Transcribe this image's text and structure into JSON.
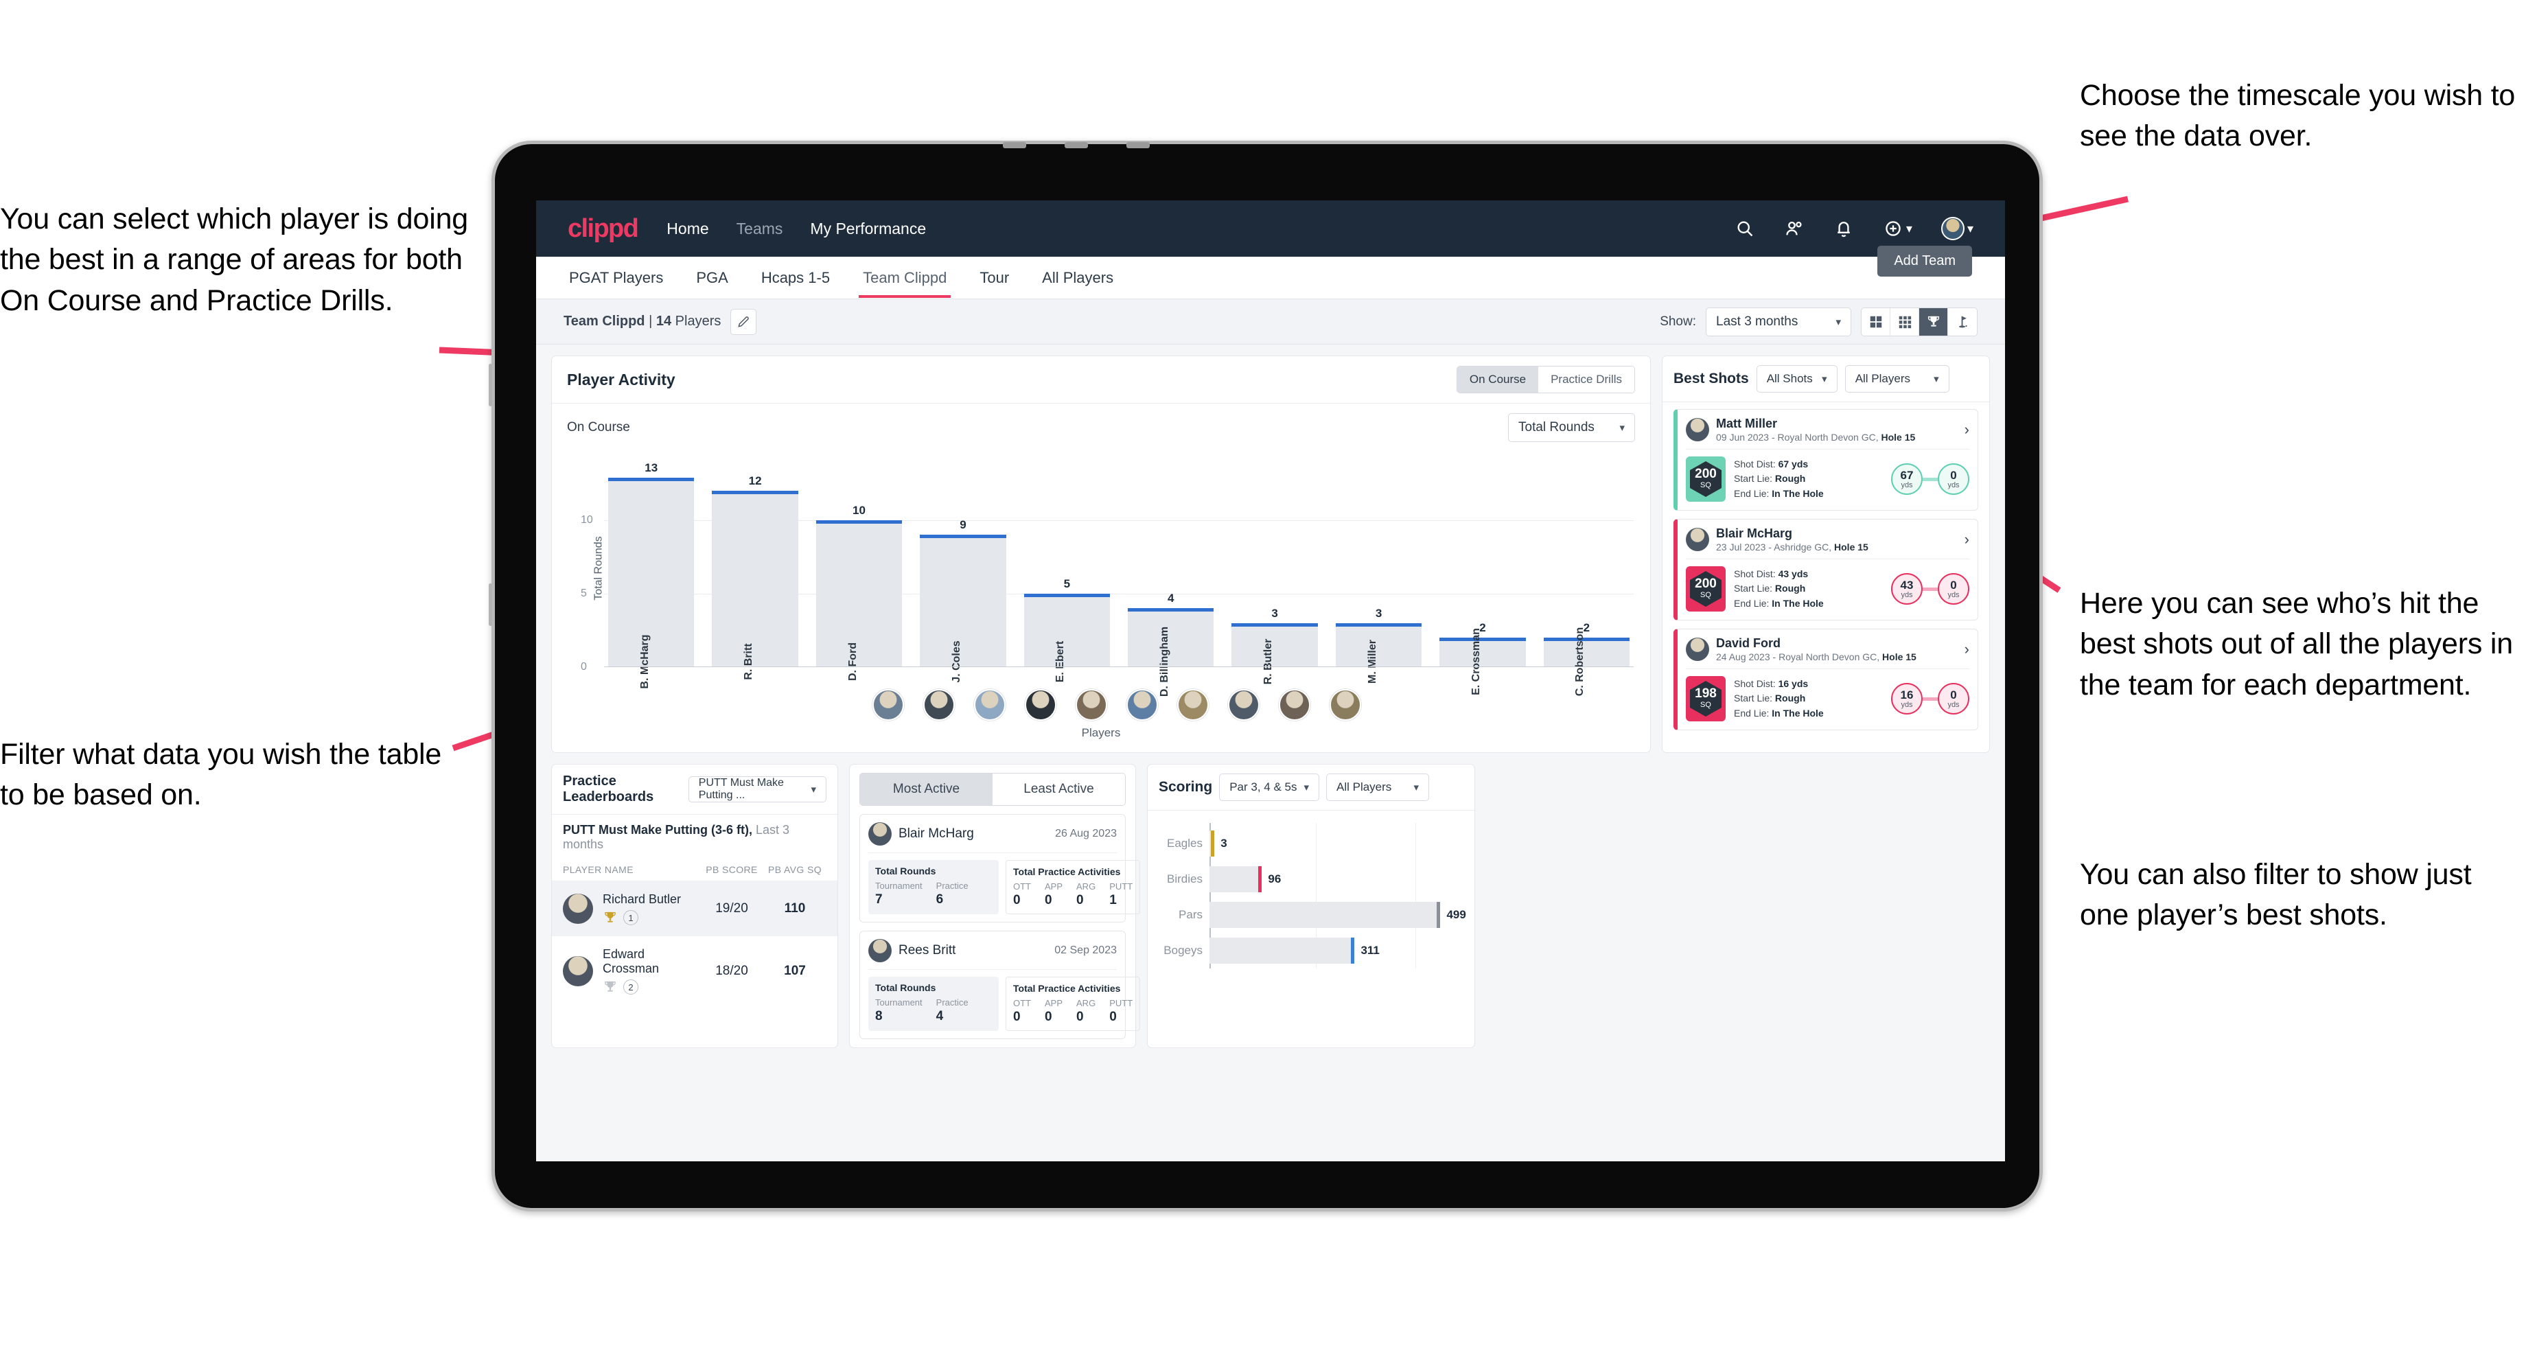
{
  "annotations": {
    "left_top": "You can select which player is doing the best in a range of areas for both On Course and Practice Drills.",
    "left_bottom": "Filter what data you wish the table to be based on.",
    "right_top": "Choose the timescale you wish to see the data over.",
    "right_mid": "Here you can see who’s hit the best shots out of all the players in the team for each department.",
    "right_bottom": "You can also filter to show just one player’s best shots."
  },
  "navbar": {
    "logo": "clippd",
    "links": [
      {
        "label": "Home",
        "active": true
      },
      {
        "label": "Teams",
        "active": false
      },
      {
        "label": "My Performance",
        "active": true
      }
    ],
    "icons": [
      "search-icon",
      "people-icon",
      "bell-icon",
      "plus-circle-icon",
      "avatar-icon"
    ]
  },
  "tabs": [
    {
      "label": "PGAT Players",
      "active": false
    },
    {
      "label": "PGA",
      "active": false
    },
    {
      "label": "Hcaps 1-5",
      "active": false
    },
    {
      "label": "Team Clippd",
      "active": true
    },
    {
      "label": "Tour",
      "active": false
    },
    {
      "label": "All Players",
      "active": false
    }
  ],
  "add_team_button": "Add Team",
  "subheader": {
    "team_name": "Team Clippd",
    "player_count": "14",
    "players_word": "Players",
    "show_label": "Show:",
    "timescale_value": "Last 3 months",
    "view_toggles": [
      {
        "name": "grid-large-icon",
        "selected": false
      },
      {
        "name": "grid-small-icon",
        "selected": false
      },
      {
        "name": "trophy-icon",
        "selected": true
      },
      {
        "name": "flag-icon",
        "selected": false
      }
    ]
  },
  "player_activity": {
    "title": "Player Activity",
    "segments": [
      {
        "label": "On Course",
        "selected": true
      },
      {
        "label": "Practice Drills",
        "selected": false
      }
    ],
    "sub_label": "On Course",
    "metric_value": "Total Rounds"
  },
  "chart_data": [
    {
      "type": "bar",
      "title": "Player Activity - On Course",
      "xlabel": "Players",
      "ylabel": "Total Rounds",
      "categories": [
        "B. McHarg",
        "R. Britt",
        "D. Ford",
        "J. Coles",
        "E. Ebert",
        "D. Billingham",
        "R. Butler",
        "M. Miller",
        "E. Crossman",
        "C. Robertson"
      ],
      "values": [
        13,
        12,
        10,
        9,
        5,
        4,
        3,
        3,
        2,
        2
      ],
      "ylim": [
        0,
        14
      ],
      "yticks": [
        0,
        5,
        10
      ],
      "grid": true,
      "bar_color": "#e4e7ec",
      "cap_color": "#2f6fd0"
    },
    {
      "type": "bar",
      "orientation": "horizontal",
      "title": "Scoring",
      "categories": [
        "Eagles",
        "Birdies",
        "Pars",
        "Bogeys"
      ],
      "values": [
        3,
        96,
        499,
        311
      ],
      "colors": [
        "#c9a227",
        "#e8305f",
        "#8a9099",
        "#3b82d6"
      ],
      "xlim": [
        0,
        560
      ],
      "grid": true
    }
  ],
  "best_shots": {
    "title": "Best Shots",
    "filter_shots": "All Shots",
    "filter_players": "All Players",
    "shots": [
      {
        "player": "Matt Miller",
        "meta_date": "09 Jun 2023",
        "meta_course": "Royal North Devon GC,",
        "meta_hole": "Hole 15",
        "badge_value": "200",
        "badge_unit": "SQ",
        "accent": "teal",
        "shot_dist_label": "Shot Dist:",
        "shot_dist": "67 yds",
        "start_lie_label": "Start Lie:",
        "start_lie": "Rough",
        "end_lie_label": "End Lie:",
        "end_lie": "In The Hole",
        "start_num": "67",
        "start_unit": "yds",
        "end_num": "0",
        "end_unit": "yds"
      },
      {
        "player": "Blair McHarg",
        "meta_date": "23 Jul 2023",
        "meta_course": "Ashridge GC,",
        "meta_hole": "Hole 15",
        "badge_value": "200",
        "badge_unit": "SQ",
        "accent": "pink",
        "shot_dist_label": "Shot Dist:",
        "shot_dist": "43 yds",
        "start_lie_label": "Start Lie:",
        "start_lie": "Rough",
        "end_lie_label": "End Lie:",
        "end_lie": "In The Hole",
        "start_num": "43",
        "start_unit": "yds",
        "end_num": "0",
        "end_unit": "yds"
      },
      {
        "player": "David Ford",
        "meta_date": "24 Aug 2023",
        "meta_course": "Royal North Devon GC,",
        "meta_hole": "Hole 15",
        "badge_value": "198",
        "badge_unit": "SQ",
        "accent": "pink",
        "shot_dist_label": "Shot Dist:",
        "shot_dist": "16 yds",
        "start_lie_label": "Start Lie:",
        "start_lie": "Rough",
        "end_lie_label": "End Lie:",
        "end_lie": "In The Hole",
        "start_num": "16",
        "start_unit": "yds",
        "end_num": "0",
        "end_unit": "yds"
      }
    ]
  },
  "practice_leaderboards": {
    "title": "Practice Leaderboards",
    "drill_select": "PUTT Must Make Putting ...",
    "subtitle_bold": "PUTT Must Make Putting (3-6 ft),",
    "subtitle_rest": " Last 3 months",
    "columns": [
      "PLAYER NAME",
      "PB SCORE",
      "PB AVG SQ"
    ],
    "rows": [
      {
        "name": "Richard Butler",
        "rank": "1",
        "score": "19/20",
        "avg": "110",
        "highlight": true,
        "trophy": "gold"
      },
      {
        "name": "Edward Crossman",
        "rank": "2",
        "score": "18/20",
        "avg": "107",
        "highlight": false,
        "trophy": "silver"
      }
    ]
  },
  "activity": {
    "tabs": [
      {
        "label": "Most Active",
        "selected": true
      },
      {
        "label": "Least Active",
        "selected": false
      }
    ],
    "items": [
      {
        "name": "Blair McHarg",
        "date": "26 Aug 2023",
        "rounds_title": "Total Rounds",
        "rounds": [
          {
            "k": "Tournament",
            "v": "7"
          },
          {
            "k": "Practice",
            "v": "6"
          }
        ],
        "practice_title": "Total Practice Activities",
        "practice": [
          {
            "k": "OTT",
            "v": "0"
          },
          {
            "k": "APP",
            "v": "0"
          },
          {
            "k": "ARG",
            "v": "0"
          },
          {
            "k": "PUTT",
            "v": "1"
          }
        ]
      },
      {
        "name": "Rees Britt",
        "date": "02 Sep 2023",
        "rounds_title": "Total Rounds",
        "rounds": [
          {
            "k": "Tournament",
            "v": "8"
          },
          {
            "k": "Practice",
            "v": "4"
          }
        ],
        "practice_title": "Total Practice Activities",
        "practice": [
          {
            "k": "OTT",
            "v": "0"
          },
          {
            "k": "APP",
            "v": "0"
          },
          {
            "k": "ARG",
            "v": "0"
          },
          {
            "k": "PUTT",
            "v": "0"
          }
        ]
      }
    ]
  },
  "scoring": {
    "title": "Scoring",
    "filter_par": "Par 3, 4 & 5s",
    "filter_players": "All Players",
    "bars": [
      {
        "label": "Eagles",
        "value": "3",
        "pct": 0.6,
        "color": "#c9a227"
      },
      {
        "label": "Birdies",
        "value": "96",
        "pct": 19.2,
        "color": "#e8305f"
      },
      {
        "label": "Pars",
        "value": "499",
        "pct": 89.1,
        "color": "#8a9099"
      },
      {
        "label": "Bogeys",
        "value": "311",
        "pct": 55.5,
        "color": "#3b82d6"
      }
    ]
  },
  "colors": {
    "brand_pink": "#ee3a63",
    "nav_dark": "#1d2b3a",
    "bar_blue": "#2f6fd0",
    "teal": "#5ecfb1"
  }
}
